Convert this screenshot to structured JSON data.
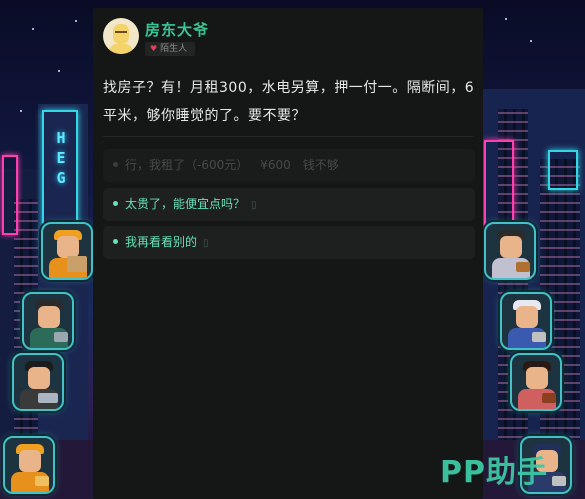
{
  "npc": {
    "name": "房东大爷",
    "relation": "陌生人",
    "avatar_icon": "old-landlord-avatar-icon",
    "heart_icon": "heart-icon"
  },
  "message": "找房子？有！月租300，水电另算，押一付一。隔断间，6平米，够你睡觉的了。要不要？",
  "options": [
    {
      "text": "行，我租了（-600元）",
      "price": "¥600",
      "note": "钱不够",
      "enabled": false
    },
    {
      "text": "太贵了，能便宜点吗？",
      "glyph": "▯",
      "enabled": true
    },
    {
      "text": "我再看看别的",
      "glyph": "▯",
      "enabled": true
    }
  ],
  "background": {
    "neon_sign_text": [
      "H",
      "E",
      "G"
    ]
  },
  "side_avatars": {
    "left": [
      {
        "name": "delivery-worker-avatar",
        "hat": "#f0a020",
        "body": "#e8901c",
        "prop": "#c9a06a"
      },
      {
        "name": "office-worker-avatar",
        "hat": "#2b2b2b",
        "body": "#2c6b57",
        "prop": "#9aa6b0"
      },
      {
        "name": "programmer-avatar",
        "hat": "#1c1c1c",
        "body": "#3a3a3a",
        "prop": "#aab4c2"
      },
      {
        "name": "courier-avatar",
        "hat": "#f0a020",
        "body": "#e8901c",
        "prop": "#f0c060"
      }
    ],
    "right": [
      {
        "name": "musician-girl-avatar",
        "hat": "#2b2b2b",
        "body": "#c0c0d0",
        "prop": "#b07030"
      },
      {
        "name": "cleaner-avatar",
        "hat": "#e8e8f0",
        "body": "#3a5ab0",
        "prop": "#c0c0c0"
      },
      {
        "name": "guitarist-avatar",
        "hat": "#2a1a14",
        "body": "#d06060",
        "prop": "#8a4020"
      },
      {
        "name": "security-guard-avatar",
        "hat": "#20305a",
        "body": "#2a3a6a",
        "prop": "#c0c0c0"
      }
    ]
  },
  "watermark": "PP助手"
}
